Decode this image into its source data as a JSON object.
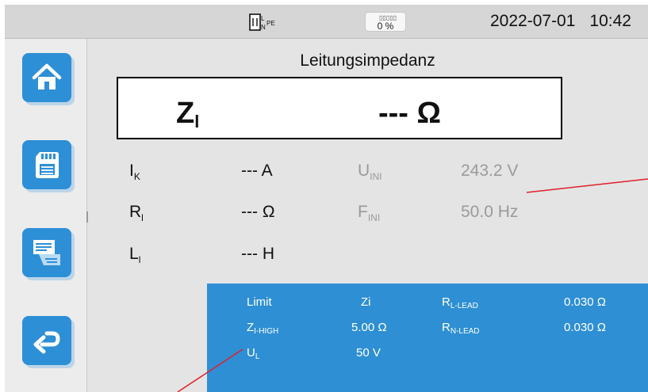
{
  "status_bar": {
    "plug_icon": "socket-l-n-pe-icon",
    "plug_label_l": "L",
    "plug_label_n": "N",
    "plug_label_pe": "PE",
    "battery_icon": "battery-icon",
    "battery_level": "0 %",
    "date": "2022-07-01",
    "time": "10:42"
  },
  "sidebar": {
    "items": [
      {
        "name": "home",
        "icon": "home-icon"
      },
      {
        "name": "memory",
        "icon": "sd-card-icon"
      },
      {
        "name": "report",
        "icon": "document-icon"
      },
      {
        "name": "back",
        "icon": "back-arrow-icon"
      }
    ]
  },
  "measurement": {
    "title": "Leitungsimpedanz",
    "main_symbol": "Z",
    "main_symbol_sub": "l",
    "main_value": "---  Ω"
  },
  "results": {
    "ik": {
      "sym": "I",
      "sub": "K",
      "value": "--- A"
    },
    "rl": {
      "sym": "R",
      "sub": "l",
      "value": "--- Ω"
    },
    "ll": {
      "sym": "L",
      "sub": "l",
      "value": "--- H"
    },
    "uini": {
      "sym": "U",
      "sub": "INI",
      "value": "243.2 V"
    },
    "fini": {
      "sym": "F",
      "sub": "INI",
      "value": "50.0 Hz"
    }
  },
  "parameters": {
    "limit_label": "Limit",
    "limit_value": "Zi",
    "zihigh_sym": "Z",
    "zihigh_sub": "I-HIGH",
    "zihigh_value": "5.00 Ω",
    "ul_sym": "U",
    "ul_sub": "L",
    "ul_value": "50 V",
    "rllead_sym": "R",
    "rllead_sub": "L-LEAD",
    "rllead_value": "0.030 Ω",
    "rnlead_sym": "R",
    "rnlead_sub": "N-LEAD",
    "rnlead_value": "0.030 Ω"
  },
  "colors": {
    "accent": "#2e8fd4",
    "callout_line": "#e0202a",
    "inactive_text": "#9a9a9a"
  }
}
